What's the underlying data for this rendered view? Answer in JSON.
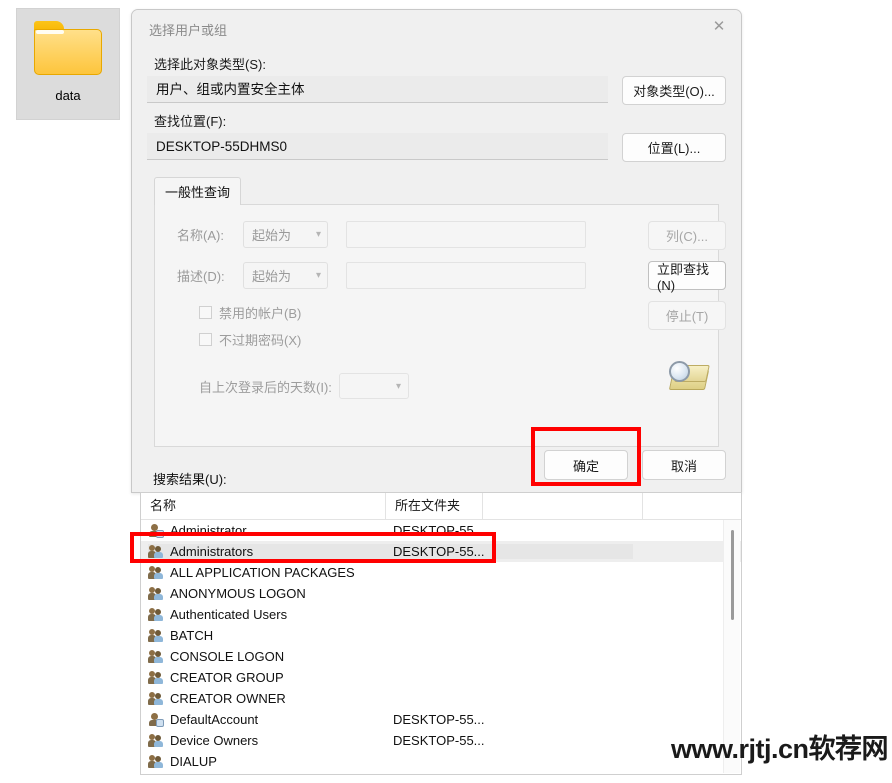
{
  "desktop": {
    "icon": {
      "label": "data",
      "glyph": "folder-icon"
    }
  },
  "dialog": {
    "title": "选择用户或组",
    "close_label": "✕",
    "object_type": {
      "label": "选择此对象类型(S):",
      "value": "用户、组或内置安全主体",
      "button": "对象类型(O)..."
    },
    "location": {
      "label": "查找位置(F):",
      "value": "DESKTOP-55DHMS0",
      "button": "位置(L)..."
    },
    "tab": {
      "label": "一般性查询"
    },
    "query": {
      "name_label": "名称(A):",
      "name_condition": "起始为",
      "name_value": "",
      "desc_label": "描述(D):",
      "desc_condition": "起始为",
      "desc_value": "",
      "disabled_accounts": "禁用的帐户(B)",
      "disabled_accounts_checked": false,
      "non_expiring_password": "不过期密码(X)",
      "non_expiring_password_checked": false,
      "days_since_login_label": "自上次登录后的天数(I):",
      "days_since_login_value": ""
    },
    "side_buttons": {
      "columns": "列(C)...",
      "find_now": "立即查找(N)",
      "stop": "停止(T)",
      "magnifier_icon": "magnifier-icon"
    },
    "footer": {
      "ok": "确定",
      "cancel": "取消"
    }
  },
  "results": {
    "label": "搜索结果(U):",
    "columns": [
      "名称",
      "所在文件夹",
      ""
    ],
    "rows": [
      {
        "icon": "user-icon",
        "name": "Administrator",
        "folder": "DESKTOP-55...",
        "selected": false
      },
      {
        "icon": "group-icon",
        "name": "Administrators",
        "folder": "DESKTOP-55...",
        "selected": true
      },
      {
        "icon": "group-icon",
        "name": "ALL APPLICATION PACKAGES",
        "folder": "",
        "selected": false
      },
      {
        "icon": "group-icon",
        "name": "ANONYMOUS LOGON",
        "folder": "",
        "selected": false
      },
      {
        "icon": "group-icon",
        "name": "Authenticated Users",
        "folder": "",
        "selected": false
      },
      {
        "icon": "group-icon",
        "name": "BATCH",
        "folder": "",
        "selected": false
      },
      {
        "icon": "group-icon",
        "name": "CONSOLE LOGON",
        "folder": "",
        "selected": false
      },
      {
        "icon": "group-icon",
        "name": "CREATOR GROUP",
        "folder": "",
        "selected": false
      },
      {
        "icon": "group-icon",
        "name": "CREATOR OWNER",
        "folder": "",
        "selected": false
      },
      {
        "icon": "user-icon",
        "name": "DefaultAccount",
        "folder": "DESKTOP-55...",
        "selected": false
      },
      {
        "icon": "group-icon",
        "name": "Device Owners",
        "folder": "DESKTOP-55...",
        "selected": false
      },
      {
        "icon": "group-icon",
        "name": "DIALUP",
        "folder": "",
        "selected": false
      }
    ]
  },
  "annotations": {
    "highlight_color": "#ff0000",
    "ok_button_highlight": "确定",
    "row_highlight": "Administrators"
  },
  "watermark": {
    "text": "www.rjtj.cn软荐网"
  }
}
